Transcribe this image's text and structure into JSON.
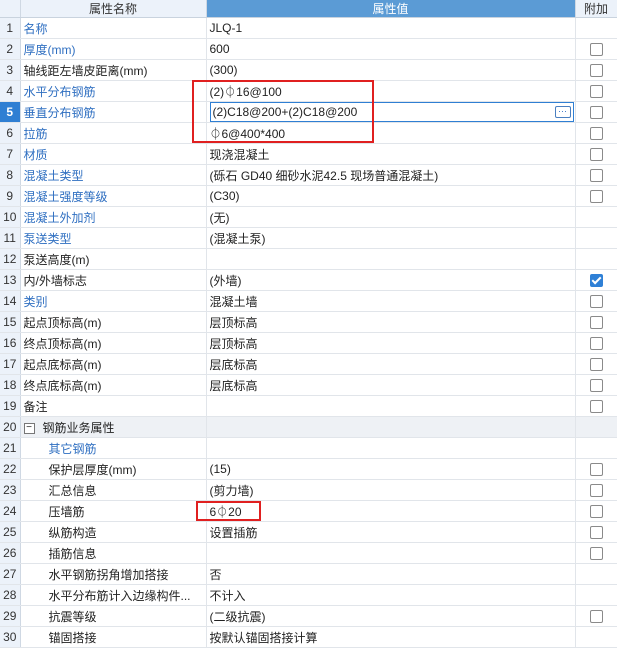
{
  "header": {
    "name": "属性名称",
    "value": "属性值",
    "extra": "附加"
  },
  "rows": [
    {
      "num": "1",
      "name": "名称",
      "value": "JLQ-1",
      "name_color": "blue",
      "checkbox": "none"
    },
    {
      "num": "2",
      "name": "厚度(mm)",
      "value": "600",
      "name_color": "blue",
      "checkbox": "unchecked"
    },
    {
      "num": "3",
      "name": "轴线距左墙皮距离(mm)",
      "value": "(300)",
      "name_color": "dark",
      "checkbox": "unchecked"
    },
    {
      "num": "4",
      "name": "水平分布钢筋",
      "value": "(2)⏀16@100",
      "name_color": "blue",
      "checkbox": "unchecked"
    },
    {
      "num": "5",
      "name": "垂直分布钢筋",
      "value": "(2)C18@200+(2)C18@200",
      "name_color": "blue",
      "checkbox": "unchecked",
      "selected": true,
      "editing": true
    },
    {
      "num": "6",
      "name": "拉筋",
      "value": "⏀6@400*400",
      "name_color": "blue",
      "checkbox": "unchecked"
    },
    {
      "num": "7",
      "name": "材质",
      "value": "现浇混凝土",
      "name_color": "blue",
      "checkbox": "unchecked"
    },
    {
      "num": "8",
      "name": "混凝土类型",
      "value": "(砾石 GD40 细砂水泥42.5 现场普通混凝土)",
      "name_color": "blue",
      "checkbox": "unchecked"
    },
    {
      "num": "9",
      "name": "混凝土强度等级",
      "value": "(C30)",
      "name_color": "blue",
      "checkbox": "unchecked"
    },
    {
      "num": "10",
      "name": "混凝土外加剂",
      "value": "(无)",
      "name_color": "blue",
      "checkbox": "none"
    },
    {
      "num": "11",
      "name": "泵送类型",
      "value": "(混凝土泵)",
      "name_color": "blue",
      "checkbox": "none"
    },
    {
      "num": "12",
      "name": "泵送高度(m)",
      "value": "",
      "name_color": "dark",
      "checkbox": "none"
    },
    {
      "num": "13",
      "name": "内/外墙标志",
      "value": "(外墙)",
      "name_color": "dark",
      "checkbox": "checked"
    },
    {
      "num": "14",
      "name": "类别",
      "value": "混凝土墙",
      "name_color": "blue",
      "checkbox": "unchecked"
    },
    {
      "num": "15",
      "name": "起点顶标高(m)",
      "value": "层顶标高",
      "name_color": "dark",
      "checkbox": "unchecked"
    },
    {
      "num": "16",
      "name": "终点顶标高(m)",
      "value": "层顶标高",
      "name_color": "dark",
      "checkbox": "unchecked"
    },
    {
      "num": "17",
      "name": "起点底标高(m)",
      "value": "层底标高",
      "name_color": "dark",
      "checkbox": "unchecked"
    },
    {
      "num": "18",
      "name": "终点底标高(m)",
      "value": "层底标高",
      "name_color": "dark",
      "checkbox": "unchecked"
    },
    {
      "num": "19",
      "name": "备注",
      "value": "",
      "name_color": "dark",
      "checkbox": "unchecked"
    },
    {
      "num": "20",
      "name": "钢筋业务属性",
      "value": "",
      "name_color": "dark",
      "checkbox": "none",
      "group": true,
      "toggle": "−"
    },
    {
      "num": "21",
      "name": "其它钢筋",
      "value": "",
      "name_color": "blue",
      "checkbox": "none",
      "indent": true
    },
    {
      "num": "22",
      "name": "保护层厚度(mm)",
      "value": "(15)",
      "name_color": "dark",
      "checkbox": "unchecked",
      "indent": true
    },
    {
      "num": "23",
      "name": "汇总信息",
      "value": "(剪力墙)",
      "name_color": "dark",
      "checkbox": "unchecked",
      "indent": true
    },
    {
      "num": "24",
      "name": "压墙筋",
      "value": "6⏀20",
      "name_color": "dark",
      "checkbox": "unchecked",
      "indent": true
    },
    {
      "num": "25",
      "name": "纵筋构造",
      "value": "设置插筋",
      "name_color": "dark",
      "checkbox": "unchecked",
      "indent": true
    },
    {
      "num": "26",
      "name": "插筋信息",
      "value": "",
      "name_color": "dark",
      "checkbox": "unchecked",
      "indent": true
    },
    {
      "num": "27",
      "name": "水平钢筋拐角增加搭接",
      "value": "否",
      "name_color": "dark",
      "checkbox": "none",
      "indent": true
    },
    {
      "num": "28",
      "name": "水平分布筋计入边缘构件...",
      "value": "不计入",
      "name_color": "dark",
      "checkbox": "none",
      "indent": true
    },
    {
      "num": "29",
      "name": "抗震等级",
      "value": "(二级抗震)",
      "name_color": "dark",
      "checkbox": "unchecked",
      "indent": true
    },
    {
      "num": "30",
      "name": "锚固搭接",
      "value": "按默认锚固搭接计算",
      "name_color": "dark",
      "checkbox": "none",
      "indent": true
    }
  ],
  "colors": {
    "header_value_bg": "#5b9bd5",
    "row_num_bg": "#ecf2fa",
    "selected_num_bg": "#2f7fd3",
    "name_blue": "#2f6fc1",
    "highlight_red": "#e02020",
    "checkbox_checked": "#2f80d6"
  },
  "icons": {
    "ellipsis_button": "ellipsis-icon",
    "collapse_toggle": "minus-box-icon",
    "checkbox": "checkbox-icon"
  }
}
